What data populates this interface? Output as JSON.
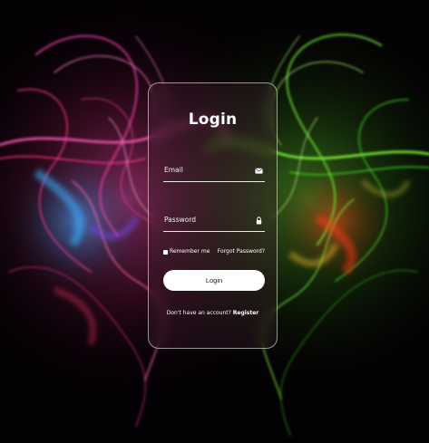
{
  "form": {
    "title": "Login",
    "email_placeholder": "Email",
    "password_placeholder": "Password",
    "remember_label": "Remember me",
    "forgot_label": "Forgot Password?",
    "login_button": "Login",
    "no_account_text": "Don't have an account?",
    "register_link": "Register"
  },
  "icons": {
    "email": "envelope-icon",
    "password": "lock-icon"
  },
  "colors": {
    "card_border": "#ffffff",
    "button_bg": "#ffffff",
    "left_glow": "#ff3d8b",
    "right_glow": "#5cff3a"
  }
}
